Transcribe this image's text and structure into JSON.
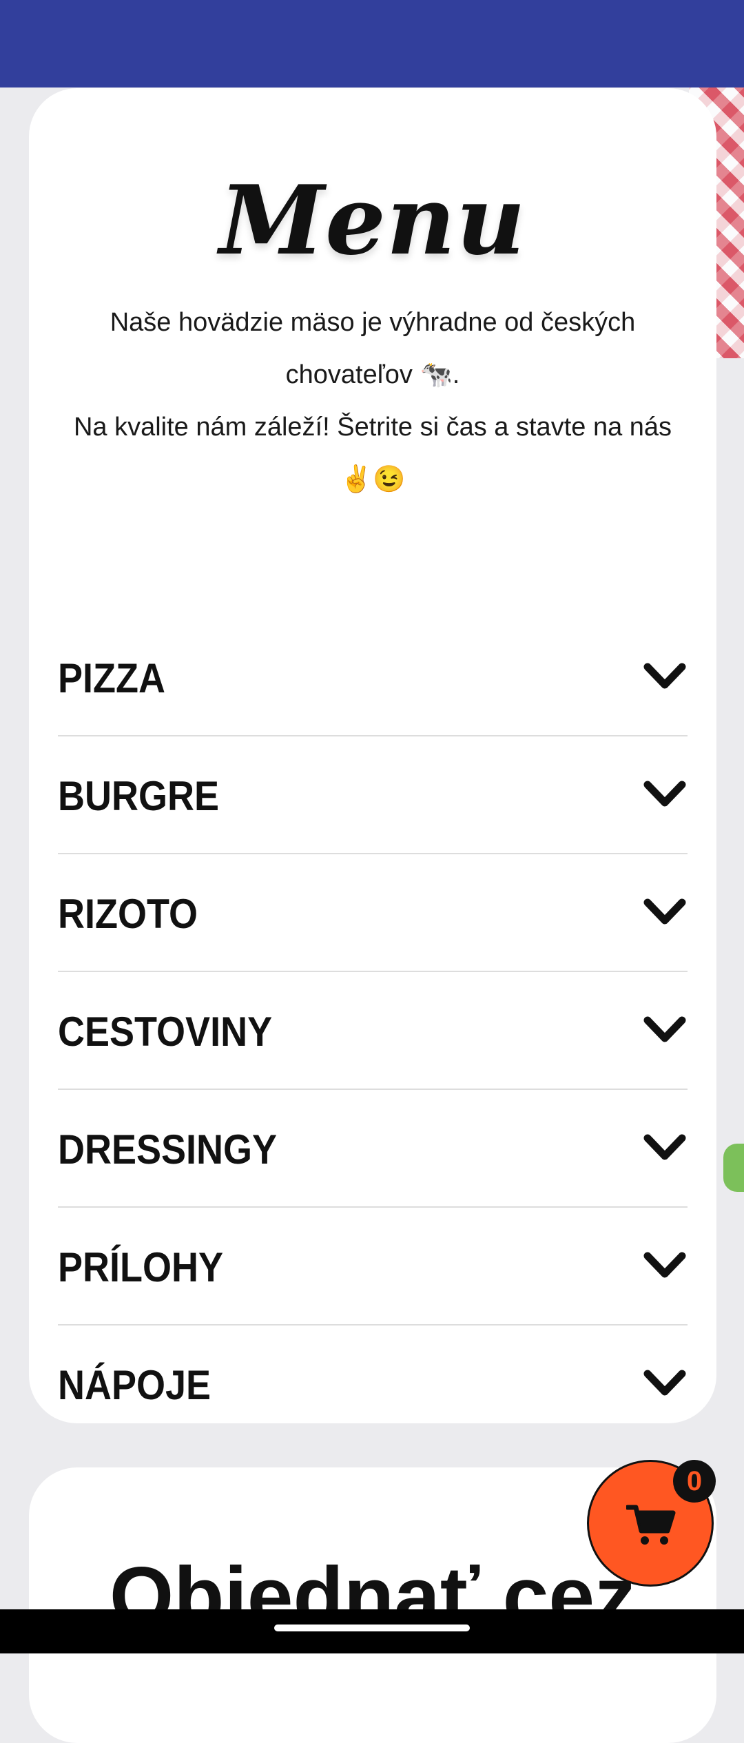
{
  "menu": {
    "title": "Menu",
    "intro_line1": "Naše hovädzie mäso je výhradne od českých chovateľov 🐄.",
    "intro_line2": "Na kvalite nám záleží! Šetrite si čas a stavte na nás ✌️😉",
    "categories": [
      {
        "label": "PIZZA",
        "icon": "chevron-down-icon"
      },
      {
        "label": "BURGRE",
        "icon": "chevron-down-icon"
      },
      {
        "label": "RIZOTO",
        "icon": "chevron-down-icon"
      },
      {
        "label": "CESTOVINY",
        "icon": "chevron-down-icon"
      },
      {
        "label": "DRESSINGY",
        "icon": "chevron-down-icon"
      },
      {
        "label": "PRÍLOHY",
        "icon": "chevron-down-icon"
      },
      {
        "label": "NÁPOJE",
        "icon": "chevron-down-icon"
      }
    ]
  },
  "order": {
    "title": "Objednať cez"
  },
  "cart": {
    "count": "0",
    "icon": "cart-icon"
  },
  "colors": {
    "status_bar": "#323f9c",
    "cart_button": "#ff5722",
    "badge": "#111111"
  }
}
